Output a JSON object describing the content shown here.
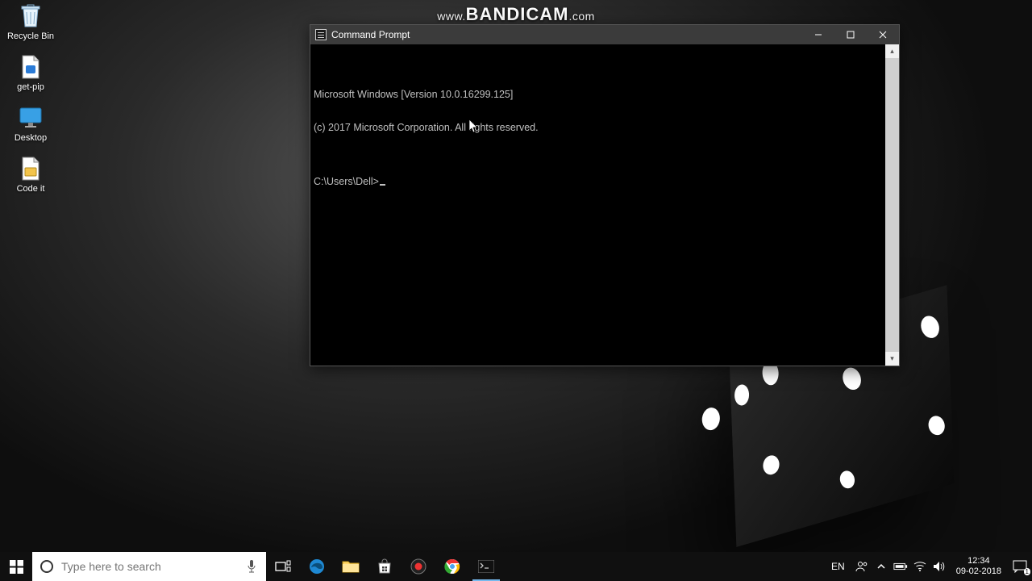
{
  "watermark": {
    "prefix": "www.",
    "main": "BANDICAM",
    "suffix": ".com"
  },
  "desktop_icons": [
    {
      "name": "recycle-bin",
      "label": "Recycle Bin"
    },
    {
      "name": "get-pip",
      "label": "get-pip"
    },
    {
      "name": "desktop-link",
      "label": "Desktop"
    },
    {
      "name": "code-it",
      "label": "Code it"
    }
  ],
  "cmd": {
    "title": "Command Prompt",
    "lines": [
      "Microsoft Windows [Version 10.0.16299.125]",
      "(c) 2017 Microsoft Corporation. All rights reserved.",
      "",
      "C:\\Users\\Dell>"
    ]
  },
  "search": {
    "placeholder": "Type here to search"
  },
  "tray": {
    "language": "EN",
    "time": "12:34",
    "date": "09-02-2018",
    "notification_count": "1"
  },
  "colors": {
    "taskbar": "#101010",
    "titlebar": "#3b3b3b",
    "terminal_fg": "#c0c0c0"
  }
}
